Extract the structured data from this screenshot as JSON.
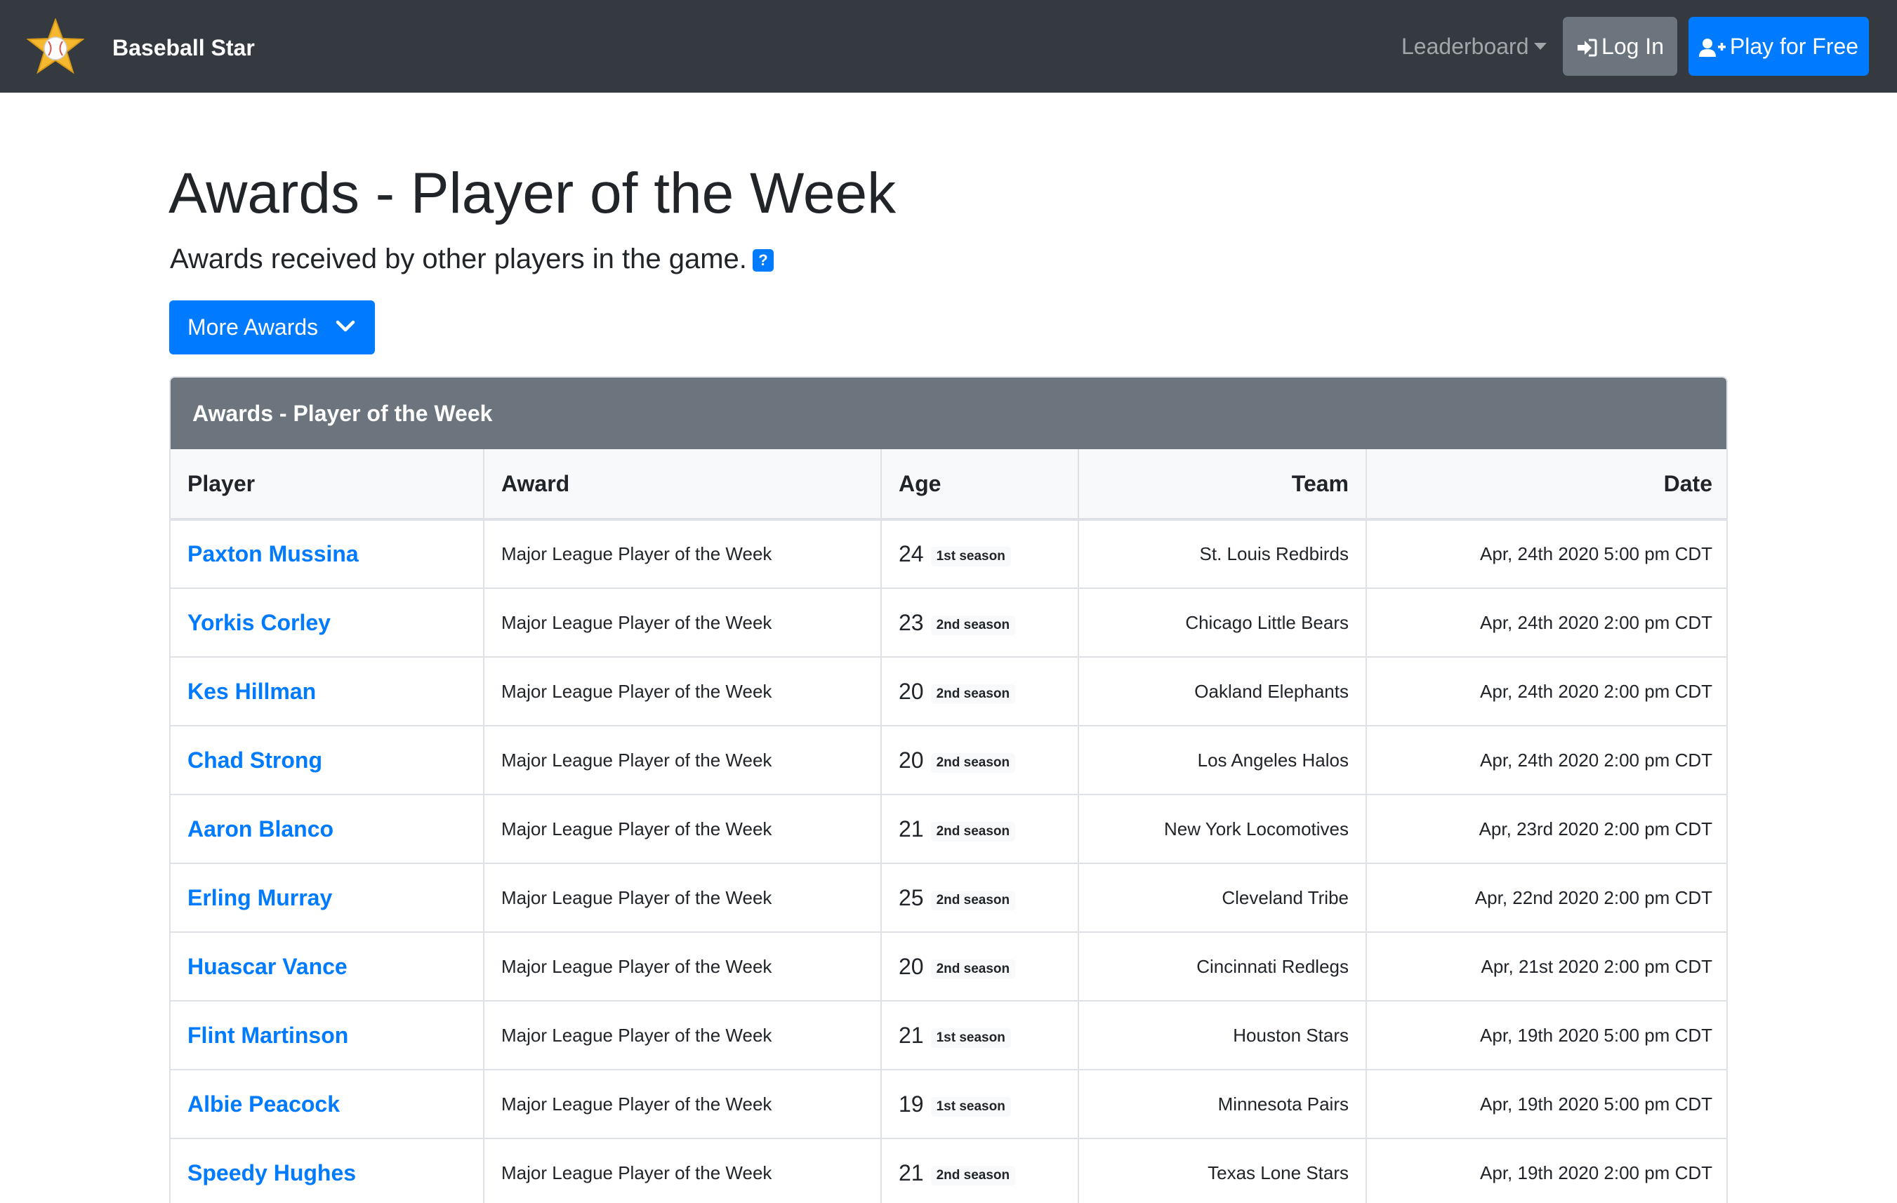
{
  "navbar": {
    "brand": "Baseball Star",
    "leaderboard": "Leaderboard",
    "login": "Log In",
    "play": "Play for Free"
  },
  "page": {
    "title": "Awards - Player of the Week",
    "lead": "Awards received by other players in the game.",
    "help": "?",
    "more_awards": "More Awards"
  },
  "table": {
    "title": "Awards - Player of the Week",
    "columns": [
      "Player",
      "Award",
      "Age",
      "Team",
      "Date"
    ],
    "rows": [
      {
        "player": "Paxton Mussina",
        "award": "Major League Player of the Week",
        "age": "24",
        "season": "1st season",
        "team": "St. Louis Redbirds",
        "date": "Apr, 24th 2020 5:00 pm CDT"
      },
      {
        "player": "Yorkis Corley",
        "award": "Major League Player of the Week",
        "age": "23",
        "season": "2nd season",
        "team": "Chicago Little Bears",
        "date": "Apr, 24th 2020 2:00 pm CDT"
      },
      {
        "player": "Kes Hillman",
        "award": "Major League Player of the Week",
        "age": "20",
        "season": "2nd season",
        "team": "Oakland Elephants",
        "date": "Apr, 24th 2020 2:00 pm CDT"
      },
      {
        "player": "Chad Strong",
        "award": "Major League Player of the Week",
        "age": "20",
        "season": "2nd season",
        "team": "Los Angeles Halos",
        "date": "Apr, 24th 2020 2:00 pm CDT"
      },
      {
        "player": "Aaron Blanco",
        "award": "Major League Player of the Week",
        "age": "21",
        "season": "2nd season",
        "team": "New York Locomotives",
        "date": "Apr, 23rd 2020 2:00 pm CDT"
      },
      {
        "player": "Erling Murray",
        "award": "Major League Player of the Week",
        "age": "25",
        "season": "2nd season",
        "team": "Cleveland Tribe",
        "date": "Apr, 22nd 2020 2:00 pm CDT"
      },
      {
        "player": "Huascar Vance",
        "award": "Major League Player of the Week",
        "age": "20",
        "season": "2nd season",
        "team": "Cincinnati Redlegs",
        "date": "Apr, 21st 2020 2:00 pm CDT"
      },
      {
        "player": "Flint Martinson",
        "award": "Major League Player of the Week",
        "age": "21",
        "season": "1st season",
        "team": "Houston Stars",
        "date": "Apr, 19th 2020 5:00 pm CDT"
      },
      {
        "player": "Albie Peacock",
        "award": "Major League Player of the Week",
        "age": "19",
        "season": "1st season",
        "team": "Minnesota Pairs",
        "date": "Apr, 19th 2020 5:00 pm CDT"
      },
      {
        "player": "Speedy Hughes",
        "award": "Major League Player of the Week",
        "age": "21",
        "season": "2nd season",
        "team": "Texas Lone Stars",
        "date": "Apr, 19th 2020 2:00 pm CDT"
      }
    ]
  },
  "colors": {
    "navbar": "#343a40",
    "primary": "#007bff",
    "secondary": "#6c757d",
    "star": "#f5b82e"
  },
  "icons": {
    "logo": "star-baseball-icon",
    "login": "sign-in-icon",
    "play": "user-plus-icon",
    "more": "chevron-down-icon"
  }
}
